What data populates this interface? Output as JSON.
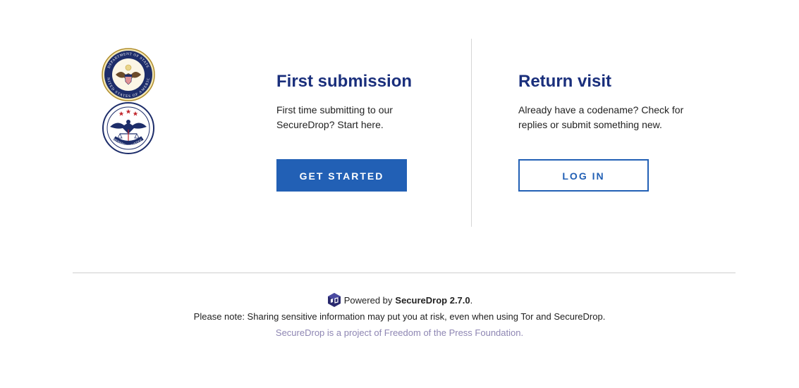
{
  "logos": {
    "state_seal_top_text": "DEPARTMENT OF STATE",
    "state_seal_bottom_text": "UNITED STATES OF AMERICA",
    "rfj_seal_left_text": "REWARDS",
    "rfj_seal_mid_text": "FOR",
    "rfj_seal_right_text": "JUSTICE"
  },
  "first_submission": {
    "title": "First submission",
    "description": "First time submitting to our SecureDrop? Start here.",
    "button_label": "GET STARTED"
  },
  "return_visit": {
    "title": "Return visit",
    "description": "Already have a codename? Check for replies or submit something new.",
    "button_label": "LOG IN"
  },
  "footer": {
    "powered_by": "Powered by",
    "product": "SecureDrop 2.7.0",
    "period": ".",
    "note": "Please note: Sharing sensitive information may put you at risk, even when using Tor and SecureDrop.",
    "project": "SecureDrop is a project of Freedom of the Press Foundation."
  },
  "colors": {
    "heading": "#1a2f7c",
    "button": "#2260b5",
    "footer_link": "#8e86b3"
  },
  "icons": [
    "department-of-state-seal",
    "rewards-for-justice-seal",
    "securedrop-logo-icon"
  ]
}
